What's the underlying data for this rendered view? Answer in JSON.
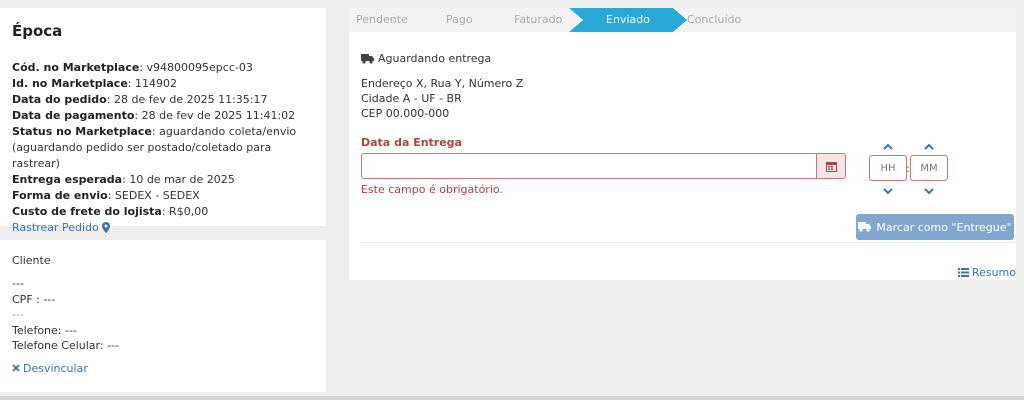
{
  "order": {
    "store_name": "Época",
    "fields": [
      {
        "label": "Cód. no Marketplace",
        "value": " v94800095epcc-03"
      },
      {
        "label": "Id. no Marketplace",
        "value": " 114902"
      },
      {
        "label": "Data do pedido",
        "value": " 28 de fev de 2025 11:35:17"
      },
      {
        "label": "Data de pagamento",
        "value": " 28 de fev de 2025 11:41:02"
      },
      {
        "label": "Status no Marketplace",
        "value": " aguardando coleta/envio"
      },
      {
        "label": "",
        "value": "(aguardando pedido ser postado/coletado para rastrear)"
      },
      {
        "label": "Entrega esperada",
        "value": " 10 de mar de 2025"
      },
      {
        "label": "Forma de envio",
        "value": " SEDEX - SEDEX"
      },
      {
        "label": "Custo de frete do lojista",
        "value": " R$0,00"
      }
    ],
    "track_link": "Rastrear Pedido"
  },
  "client": {
    "title": "Cliente",
    "name": "---",
    "cpf": "CPF : ---",
    "extra": "---",
    "phone": "Telefone: ---",
    "mobile": "Telefone Celular: ---",
    "unlink": "Desvincular"
  },
  "steps": [
    "Pendente",
    "Pago",
    "Faturado",
    "Enviado",
    "Concluído"
  ],
  "shipping": {
    "status": "Aguardando entrega",
    "address_line1": "Endereço X, Rua Y, Número Z",
    "address_line2": "Cidade A - UF - BR",
    "address_line3": "CEP 00.000-000"
  },
  "delivery": {
    "label": "Data da Entrega",
    "value": "",
    "error": "Este campo é obrigatório.",
    "hour_placeholder": "HH",
    "minute_placeholder": "MM",
    "time_separator": ":",
    "mark_button": "Marcar como \"Entregue\""
  },
  "summary_link": "Resumo",
  "colors": {
    "accent": "#29a8d8",
    "link": "#3a73b0",
    "error": "#a94442",
    "button": "#7fa7cf"
  }
}
